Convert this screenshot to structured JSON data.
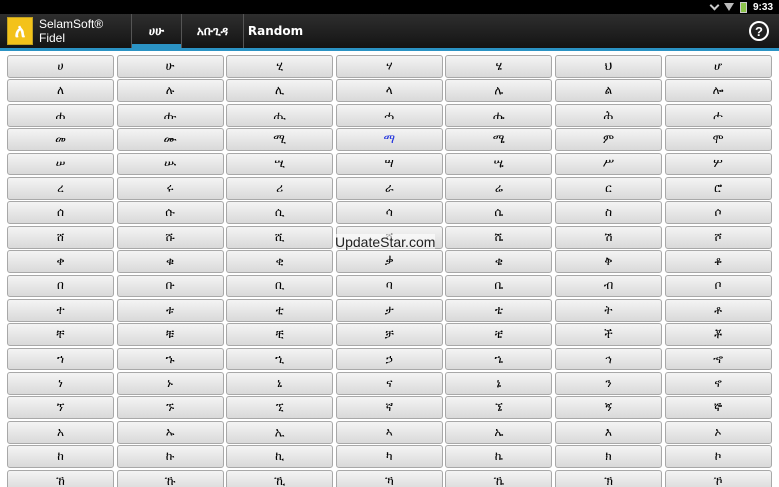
{
  "status": {
    "time": "9:33"
  },
  "app": {
    "title": "SelamSoft® Fidel",
    "logo_glyph": "ለ"
  },
  "tabs": [
    {
      "label": "ሀሁ",
      "active": true
    },
    {
      "label": "አቡጊዳ",
      "active": false
    },
    {
      "label": "Random",
      "active": false
    }
  ],
  "help_label": "?",
  "watermark": "UpdateStar.com",
  "accent_color": "#2b93c4",
  "highlight_color": "#2233dd",
  "grid": [
    [
      "ሀ",
      "ሁ",
      "ሂ",
      "ሃ",
      "ሄ",
      "ህ",
      "ሆ"
    ],
    [
      "ለ",
      "ሉ",
      "ሊ",
      "ላ",
      "ሌ",
      "ል",
      "ሎ"
    ],
    [
      "ሐ",
      "ሑ",
      "ሒ",
      "ሓ",
      "ሔ",
      "ሕ",
      "ሖ"
    ],
    [
      "መ",
      "ሙ",
      "ሚ",
      "ማ",
      "ሜ",
      "ም",
      "ሞ"
    ],
    [
      "ሠ",
      "ሡ",
      "ሢ",
      "ሣ",
      "ሤ",
      "ሥ",
      "ሦ"
    ],
    [
      "ረ",
      "ሩ",
      "ሪ",
      "ራ",
      "ሬ",
      "ር",
      "ሮ"
    ],
    [
      "ሰ",
      "ሱ",
      "ሲ",
      "ሳ",
      "ሴ",
      "ስ",
      "ሶ"
    ],
    [
      "ሸ",
      "ሹ",
      "ሺ",
      "ሻ",
      "ሼ",
      "ሽ",
      "ሾ"
    ],
    [
      "ቀ",
      "ቁ",
      "ቂ",
      "ቃ",
      "ቄ",
      "ቅ",
      "ቆ"
    ],
    [
      "በ",
      "ቡ",
      "ቢ",
      "ባ",
      "ቤ",
      "ብ",
      "ቦ"
    ],
    [
      "ተ",
      "ቱ",
      "ቲ",
      "ታ",
      "ቴ",
      "ት",
      "ቶ"
    ],
    [
      "ቸ",
      "ቹ",
      "ቺ",
      "ቻ",
      "ቼ",
      "ች",
      "ቾ"
    ],
    [
      "ኀ",
      "ኁ",
      "ኂ",
      "ኃ",
      "ኄ",
      "ኅ",
      "ኆ"
    ],
    [
      "ነ",
      "ኑ",
      "ኒ",
      "ና",
      "ኔ",
      "ን",
      "ኖ"
    ],
    [
      "ኘ",
      "ኙ",
      "ኚ",
      "ኛ",
      "ኜ",
      "ኝ",
      "ኞ"
    ],
    [
      "አ",
      "ኡ",
      "ኢ",
      "ኣ",
      "ኤ",
      "እ",
      "ኦ"
    ],
    [
      "ከ",
      "ኩ",
      "ኪ",
      "ካ",
      "ኬ",
      "ክ",
      "ኮ"
    ],
    [
      "ኸ",
      "ኹ",
      "ኺ",
      "ኻ",
      "ኼ",
      "ኽ",
      "ኾ"
    ]
  ],
  "highlighted_cell": {
    "row": 3,
    "col": 3
  }
}
